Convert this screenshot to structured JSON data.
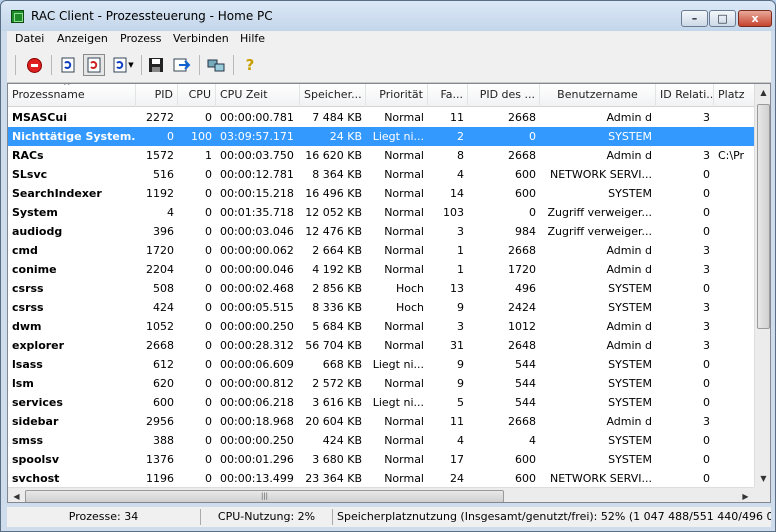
{
  "window": {
    "title": "RAC Client - Prozessteuerung - Home PC"
  },
  "menu": [
    "Datei",
    "Anzeigen",
    "Prozess",
    "Verbinden",
    "Hilfe"
  ],
  "toolbar": {
    "icons": [
      "stop-process-icon",
      "refresh-icon",
      "auto-refresh-icon",
      "refresh-interval-icon",
      "save-icon",
      "export-icon",
      "connect-icon",
      "help-icon"
    ],
    "help_glyph": "?"
  },
  "columns": [
    "Prozessname",
    "PID",
    "CPU",
    "CPU Zeit",
    "Speicher...",
    "Priorität",
    "Fa...",
    "PID des ...",
    "Benutzername",
    "ID Relati...",
    "Platz"
  ],
  "rows": [
    [
      "MSASCui",
      "2272",
      "0",
      "00:00:00.781",
      "7 484 KB",
      "Normal",
      "11",
      "2668",
      "Admin d",
      "3",
      ""
    ],
    [
      "Nichttätige System...",
      "0",
      "100",
      "03:09:57.171",
      "24 KB",
      "Liegt ni...",
      "2",
      "0",
      "SYSTEM",
      "",
      ""
    ],
    [
      "RACs",
      "1572",
      "1",
      "00:00:03.750",
      "16 620 KB",
      "Normal",
      "8",
      "2668",
      "Admin d",
      "3",
      "C:\\Pr"
    ],
    [
      "SLsvc",
      "516",
      "0",
      "00:00:12.781",
      "8 364 KB",
      "Normal",
      "4",
      "600",
      "NETWORK SERVI...",
      "0",
      ""
    ],
    [
      "SearchIndexer",
      "1192",
      "0",
      "00:00:15.218",
      "16 496 KB",
      "Normal",
      "14",
      "600",
      "SYSTEM",
      "0",
      ""
    ],
    [
      "System",
      "4",
      "0",
      "00:01:35.718",
      "12 052 KB",
      "Normal",
      "103",
      "0",
      "Zugriff verweiger...",
      "0",
      ""
    ],
    [
      "audiodg",
      "396",
      "0",
      "00:00:03.046",
      "12 476 KB",
      "Normal",
      "3",
      "984",
      "Zugriff verweiger...",
      "0",
      ""
    ],
    [
      "cmd",
      "1720",
      "0",
      "00:00:00.062",
      "2 664 KB",
      "Normal",
      "1",
      "2668",
      "Admin d",
      "3",
      ""
    ],
    [
      "conime",
      "2204",
      "0",
      "00:00:00.046",
      "4 192 KB",
      "Normal",
      "1",
      "1720",
      "Admin d",
      "3",
      ""
    ],
    [
      "csrss",
      "508",
      "0",
      "00:00:02.468",
      "2 856 KB",
      "Hoch",
      "13",
      "496",
      "SYSTEM",
      "0",
      ""
    ],
    [
      "csrss",
      "424",
      "0",
      "00:00:05.515",
      "8 336 KB",
      "Hoch",
      "9",
      "2424",
      "SYSTEM",
      "3",
      ""
    ],
    [
      "dwm",
      "1052",
      "0",
      "00:00:00.250",
      "5 684 KB",
      "Normal",
      "3",
      "1012",
      "Admin d",
      "3",
      ""
    ],
    [
      "explorer",
      "2668",
      "0",
      "00:00:28.312",
      "56 704 KB",
      "Normal",
      "31",
      "2648",
      "Admin d",
      "3",
      ""
    ],
    [
      "lsass",
      "612",
      "0",
      "00:00:06.609",
      "668 KB",
      "Liegt ni...",
      "9",
      "544",
      "SYSTEM",
      "0",
      ""
    ],
    [
      "lsm",
      "620",
      "0",
      "00:00:00.812",
      "2 572 KB",
      "Normal",
      "9",
      "544",
      "SYSTEM",
      "0",
      ""
    ],
    [
      "services",
      "600",
      "0",
      "00:00:06.218",
      "3 616 KB",
      "Liegt ni...",
      "5",
      "544",
      "SYSTEM",
      "0",
      ""
    ],
    [
      "sidebar",
      "2956",
      "0",
      "00:00:18.968",
      "20 604 KB",
      "Normal",
      "11",
      "2668",
      "Admin d",
      "3",
      ""
    ],
    [
      "smss",
      "388",
      "0",
      "00:00:00.250",
      "424 KB",
      "Normal",
      "4",
      "4",
      "SYSTEM",
      "0",
      ""
    ],
    [
      "spoolsv",
      "1376",
      "0",
      "00:00:01.296",
      "3 680 KB",
      "Normal",
      "17",
      "600",
      "SYSTEM",
      "0",
      ""
    ],
    [
      "svchost",
      "1196",
      "0",
      "00:00:13.499",
      "23 364 KB",
      "Normal",
      "24",
      "600",
      "NETWORK SERVI...",
      "0",
      ""
    ]
  ],
  "selected_row": 1,
  "status": {
    "processes": "Prozesse: 34",
    "cpu": "CPU-Nutzung: 2%",
    "memory": "Speicherplatznutzung (Insgesamt/genutzt/frei): 52% (1 047 488/551 440/496 048"
  },
  "colors": {
    "selection": "#3399ff",
    "accent": "#5a6f85"
  }
}
